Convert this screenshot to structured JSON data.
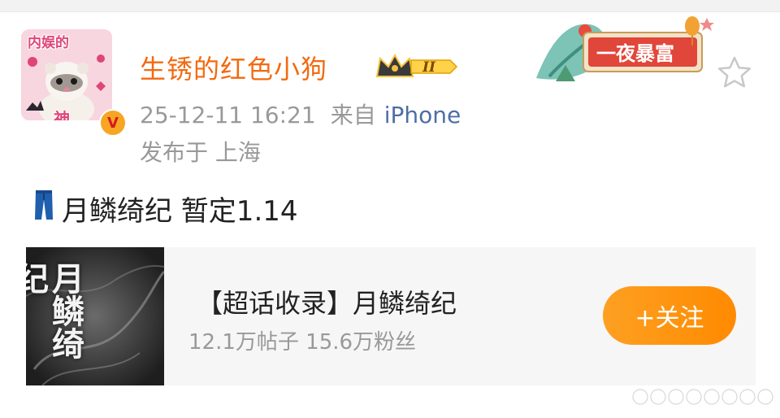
{
  "post": {
    "avatar": {
      "top_text": "内娱的",
      "bottom_text": "神",
      "verified_mark": "V"
    },
    "username": "生锈的红色小狗",
    "level_badge": "II",
    "date_time": "25-12-11 16:21",
    "source_label": "来自",
    "device": "iPhone",
    "location": "发布于 上海",
    "decoration_text": "一夜暴富",
    "content_emoji": "👖",
    "content_text": "月鳞绮纪 暂定1.14"
  },
  "supertopic_card": {
    "thumbnail_title": "月鳞绮纪",
    "title": "【超话收录】月鳞绮纪",
    "stats": "12.1万帖子 15.6万粉丝",
    "follow_label": "+关注"
  },
  "colors": {
    "username": "#f26a10",
    "meta_gray": "#999999",
    "device_blue": "#4e6ea7",
    "follow_orange": "#ff8a00",
    "card_bg": "#f6f6f6"
  },
  "icons": [
    "verified-v-icon",
    "crown-level-icon",
    "star-favorite-icon",
    "jeans-emoji-icon",
    "watermark-dots-icon"
  ]
}
